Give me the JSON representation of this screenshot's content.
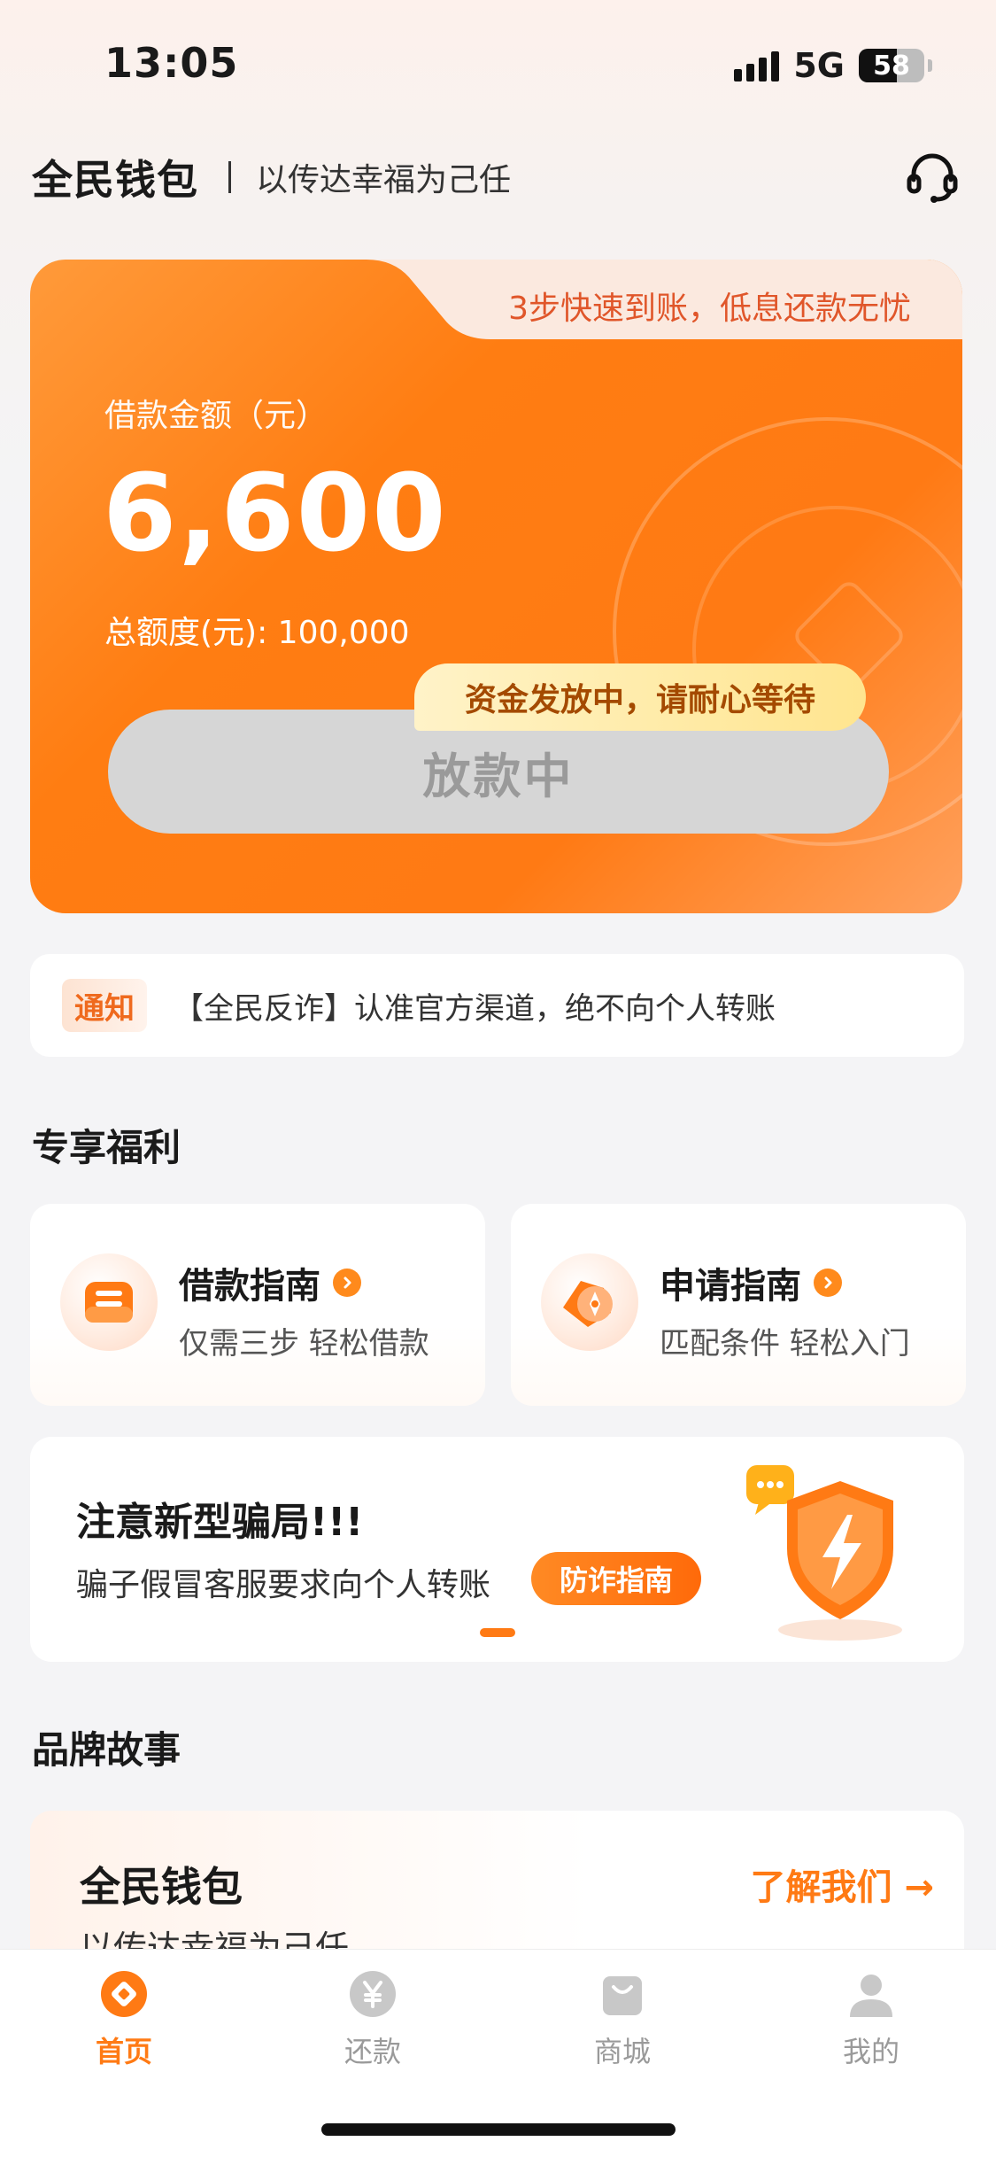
{
  "status_bar": {
    "time": "13:05",
    "network": "5G",
    "battery": "58",
    "battery_fraction": 0.58
  },
  "header": {
    "brand": "全民钱包",
    "slogan": "以传达幸福为己任",
    "support_icon": "headset-icon"
  },
  "loan_card": {
    "promo": "3步快速到账，低息还款无忧",
    "amount_label": "借款金额（元）",
    "amount": "6,600",
    "total_label": "总额度(元): 100,000",
    "status_bubble": "资金发放中，请耐心等待",
    "button_label": "放款中"
  },
  "notice": {
    "tag": "通知",
    "text": "【全民反诈】认准官方渠道，绝不向个人转账"
  },
  "benefits": {
    "title": "专享福利",
    "items": [
      {
        "title": "借款指南",
        "subtitle": "仅需三步 轻松借款",
        "icon": "loan-guide-icon"
      },
      {
        "title": "申请指南",
        "subtitle": "匹配条件 轻松入门",
        "icon": "compass-icon"
      }
    ]
  },
  "fraud_banner": {
    "title": "注意新型骗局!!!",
    "subtitle": "骗子假冒客服要求向个人转账",
    "button": "防诈指南",
    "icon": "shield-icon"
  },
  "brand_story": {
    "title": "品牌故事",
    "card_title": "全民钱包",
    "card_slogan": "以传达幸福为己任",
    "link": "了解我们 →"
  },
  "tab_bar": {
    "items": [
      {
        "label": "首页",
        "icon": "home-icon",
        "active": true
      },
      {
        "label": "还款",
        "icon": "yen-coin-icon",
        "active": false
      },
      {
        "label": "商城",
        "icon": "shopping-bag-icon",
        "active": false
      },
      {
        "label": "我的",
        "icon": "person-icon",
        "active": false
      }
    ]
  },
  "colors": {
    "accent": "#ff7a14",
    "background": "#f4f4f6",
    "inactive": "#9a9a9a"
  }
}
